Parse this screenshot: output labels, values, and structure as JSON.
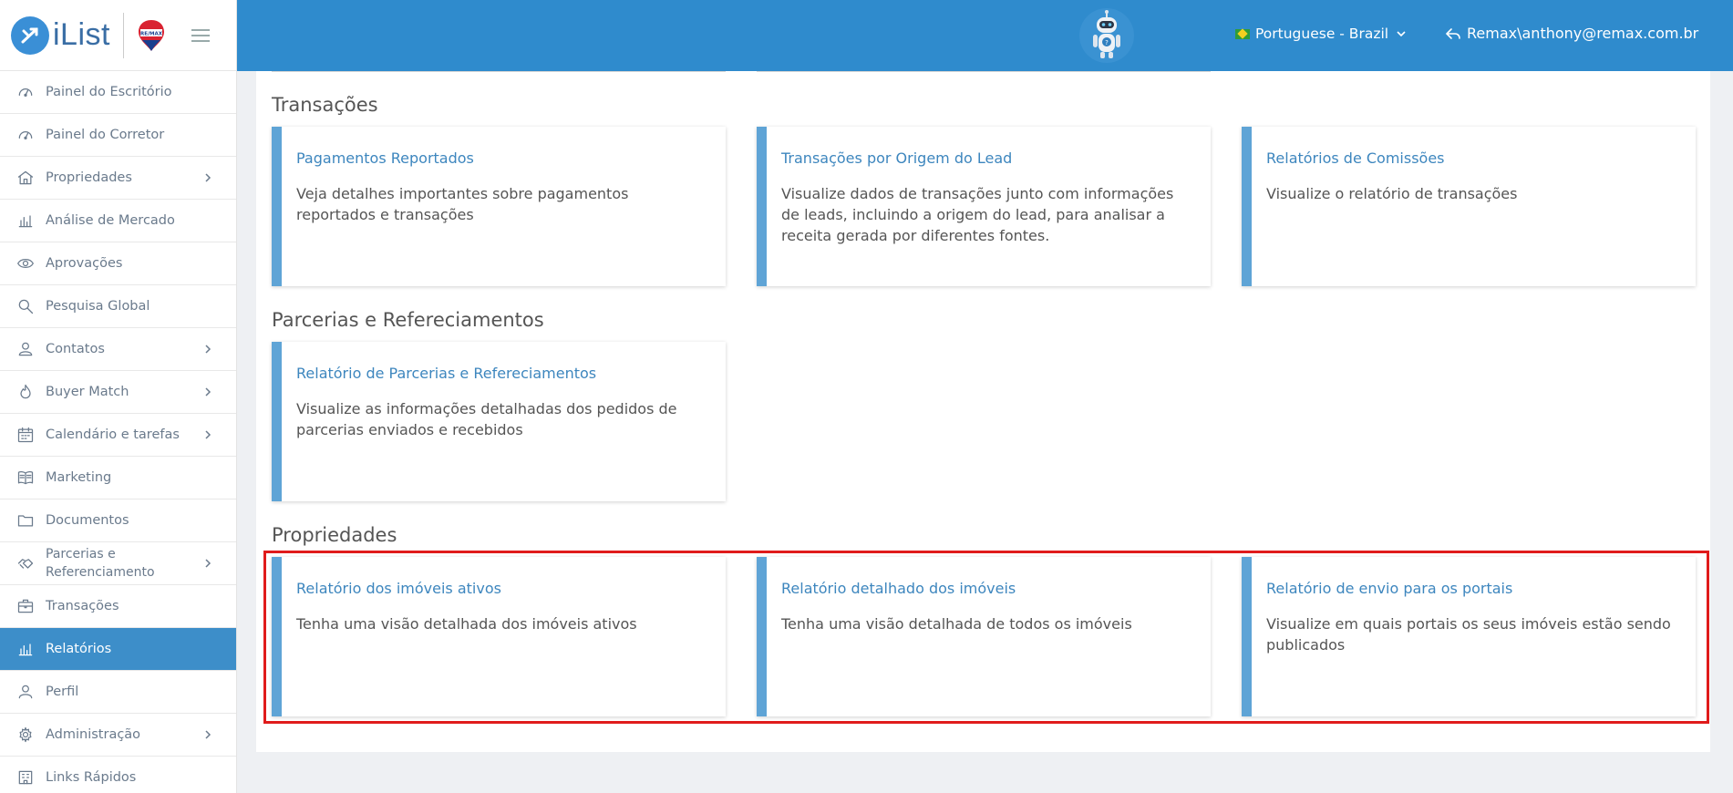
{
  "brand": {
    "logo_text": "iList"
  },
  "sidebar": {
    "items": [
      {
        "label": "Painel do Escritório",
        "icon": "gauge-icon",
        "chevron": false,
        "active": false
      },
      {
        "label": "Painel do Corretor",
        "icon": "gauge-icon",
        "chevron": false,
        "active": false
      },
      {
        "label": "Propriedades",
        "icon": "home-icon",
        "chevron": true,
        "active": false
      },
      {
        "label": "Análise de Mercado",
        "icon": "bar-chart-icon",
        "chevron": false,
        "active": false
      },
      {
        "label": "Aprovações",
        "icon": "eye-icon",
        "chevron": false,
        "active": false
      },
      {
        "label": "Pesquisa Global",
        "icon": "search-icon",
        "chevron": false,
        "active": false
      },
      {
        "label": "Contatos",
        "icon": "contacts-icon",
        "chevron": true,
        "active": false
      },
      {
        "label": "Buyer Match",
        "icon": "fire-icon",
        "chevron": true,
        "active": false
      },
      {
        "label": "Calendário e tarefas",
        "icon": "calendar-icon",
        "chevron": true,
        "active": false
      },
      {
        "label": "Marketing",
        "icon": "book-icon",
        "chevron": false,
        "active": false
      },
      {
        "label": "Documentos",
        "icon": "folder-icon",
        "chevron": false,
        "active": false
      },
      {
        "label": "Parcerias e Referenciamento",
        "icon": "handshake-icon",
        "chevron": true,
        "active": false
      },
      {
        "label": "Transações",
        "icon": "briefcase-icon",
        "chevron": false,
        "active": false
      },
      {
        "label": "Relatórios",
        "icon": "bar-chart-icon",
        "chevron": false,
        "active": true
      },
      {
        "label": "Perfil",
        "icon": "user-icon",
        "chevron": false,
        "active": false
      },
      {
        "label": "Administração",
        "icon": "gear-icon",
        "chevron": true,
        "active": false
      },
      {
        "label": "Links Rápidos",
        "icon": "building-icon",
        "chevron": false,
        "active": false
      }
    ]
  },
  "topbar": {
    "language": "Portuguese - Brazil",
    "user": "Remax\\anthony@remax.com.br"
  },
  "sections": [
    {
      "title": "Transações",
      "cards": [
        {
          "title": "Pagamentos Reportados",
          "desc": "Veja detalhes importantes sobre pagamentos reportados e transações"
        },
        {
          "title": "Transações por Origem do Lead",
          "desc": "Visualize dados de transações junto com informações de leads, incluindo a origem do lead, para analisar a receita gerada por diferentes fontes."
        },
        {
          "title": "Relatórios de Comissões",
          "desc": "Visualize o relatório de transações"
        }
      ]
    },
    {
      "title": "Parcerias e Refereciamentos",
      "cards": [
        {
          "title": "Relatório de Parcerias e Refereciamentos",
          "desc": "Visualize as informações detalhadas dos pedidos de parcerias enviados e recebidos"
        }
      ]
    },
    {
      "title": "Propriedades",
      "cards": [
        {
          "title": "Relatório dos imóveis ativos",
          "desc": "Tenha uma visão detalhada dos imóveis ativos"
        },
        {
          "title": "Relatório detalhado dos imóveis",
          "desc": "Tenha uma visão detalhada de todos os imóveis"
        },
        {
          "title": "Relatório de envio para os portais",
          "desc": "Visualize em quais portais os seus imóveis estão sendo publicados"
        }
      ]
    }
  ],
  "colors": {
    "topbar": "#2f8bcd",
    "active_nav": "#3d8ec9",
    "card_accent": "#5fa4d6",
    "highlight": "#e01b1b"
  }
}
